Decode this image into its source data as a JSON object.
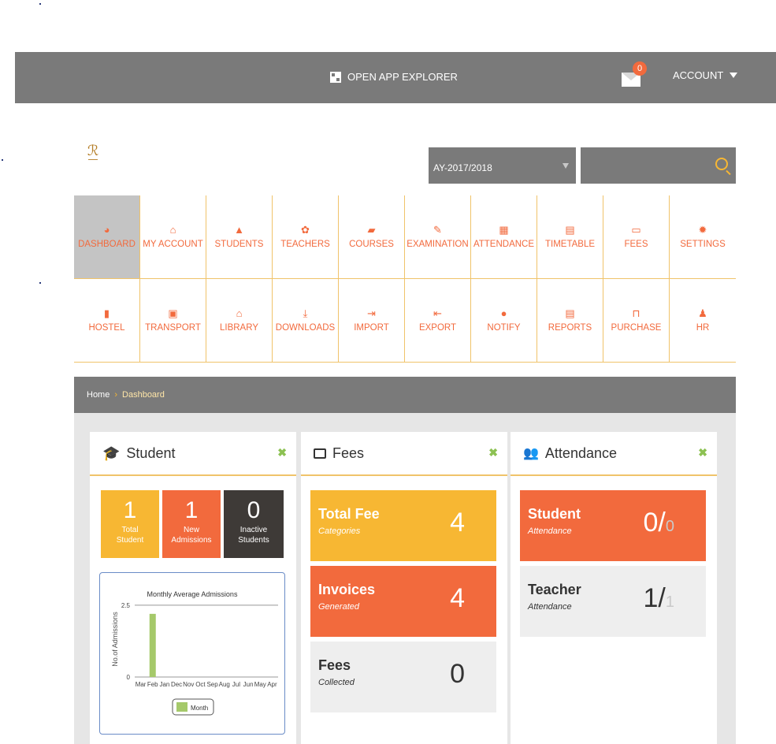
{
  "topbar": {
    "app_explorer_label": "OPEN APP EXPLORER",
    "mail_count": "0",
    "account_label": "ACCOUNT"
  },
  "filters": {
    "academic_year": "AY-2017/2018",
    "search_value": ""
  },
  "menu": [
    {
      "label": "DASHBOARD",
      "icon": "dashboard-icon"
    },
    {
      "label": "MY ACCOUNT",
      "icon": "home-icon"
    },
    {
      "label": "STUDENTS",
      "icon": "graduation-cap-icon"
    },
    {
      "label": "TEACHERS",
      "icon": "users-icon"
    },
    {
      "label": "COURSES",
      "icon": "folder-icon"
    },
    {
      "label": "EXAMINATION",
      "icon": "edit-icon"
    },
    {
      "label": "ATTENDANCE",
      "icon": "calendar-icon"
    },
    {
      "label": "TIMETABLE",
      "icon": "calendar-clock-icon"
    },
    {
      "label": "FEES",
      "icon": "credit-card-icon"
    },
    {
      "label": "SETTINGS",
      "icon": "gear-icon"
    },
    {
      "label": "HOSTEL",
      "icon": "building-icon"
    },
    {
      "label": "TRANSPORT",
      "icon": "bus-icon"
    },
    {
      "label": "LIBRARY",
      "icon": "bank-icon"
    },
    {
      "label": "DOWNLOADS",
      "icon": "download-icon"
    },
    {
      "label": "IMPORT",
      "icon": "sign-in-icon"
    },
    {
      "label": "EXPORT",
      "icon": "sign-out-icon"
    },
    {
      "label": "NOTIFY",
      "icon": "chat-icon"
    },
    {
      "label": "REPORTS",
      "icon": "newspaper-icon"
    },
    {
      "label": "PURCHASE",
      "icon": "cart-icon"
    },
    {
      "label": "HR",
      "icon": "user-icon"
    }
  ],
  "breadcrumb": {
    "home": "Home",
    "current": "Dashboard"
  },
  "student_panel": {
    "title": "Student",
    "stats": [
      {
        "value": "1",
        "label_line1": "Total",
        "label_line2": "Student",
        "color": "#f7b733"
      },
      {
        "value": "1",
        "label_line1": "New",
        "label_line2": "Admissions",
        "color": "#f26a3d"
      },
      {
        "value": "0",
        "label_line1": "Inactive",
        "label_line2": "Students",
        "color": "#3e3a37"
      }
    ]
  },
  "fees_panel": {
    "title": "Fees",
    "tiles": [
      {
        "name": "Total Fee",
        "sub": "Categories",
        "value": "4",
        "style": "yellow"
      },
      {
        "name": "Invoices",
        "sub": "Generated",
        "value": "4",
        "style": "orange"
      },
      {
        "name": "Fees",
        "sub": "Collected",
        "value": "0",
        "style": "gray"
      }
    ]
  },
  "attendance_panel": {
    "title": "Attendance",
    "tiles": [
      {
        "name": "Student",
        "sub": "Attendance",
        "value": "0/",
        "total": "0",
        "style": "orange"
      },
      {
        "name": "Teacher",
        "sub": "Attendance",
        "value": "1/",
        "total": "1",
        "style": "gray"
      }
    ]
  },
  "chart_data": {
    "type": "bar",
    "title": "Monthly Average Admissions",
    "ylabel": "No.of Admissions",
    "xlabel": "",
    "categories": [
      "Mar",
      "Feb",
      "Jan",
      "Dec",
      "Nov",
      "Oct",
      "Sep",
      "Aug",
      "Jul",
      "Jun",
      "May",
      "Apr"
    ],
    "series": [
      {
        "name": "Month",
        "values": [
          0,
          2.2,
          0,
          0,
          0,
          0,
          0,
          0,
          0,
          0,
          0,
          0
        ]
      }
    ],
    "yticks": [
      "0",
      "2.5"
    ],
    "ylim": [
      0,
      2.8
    ],
    "grid": true,
    "legend": "bottom-center",
    "bar_color": "#a5c96a"
  }
}
